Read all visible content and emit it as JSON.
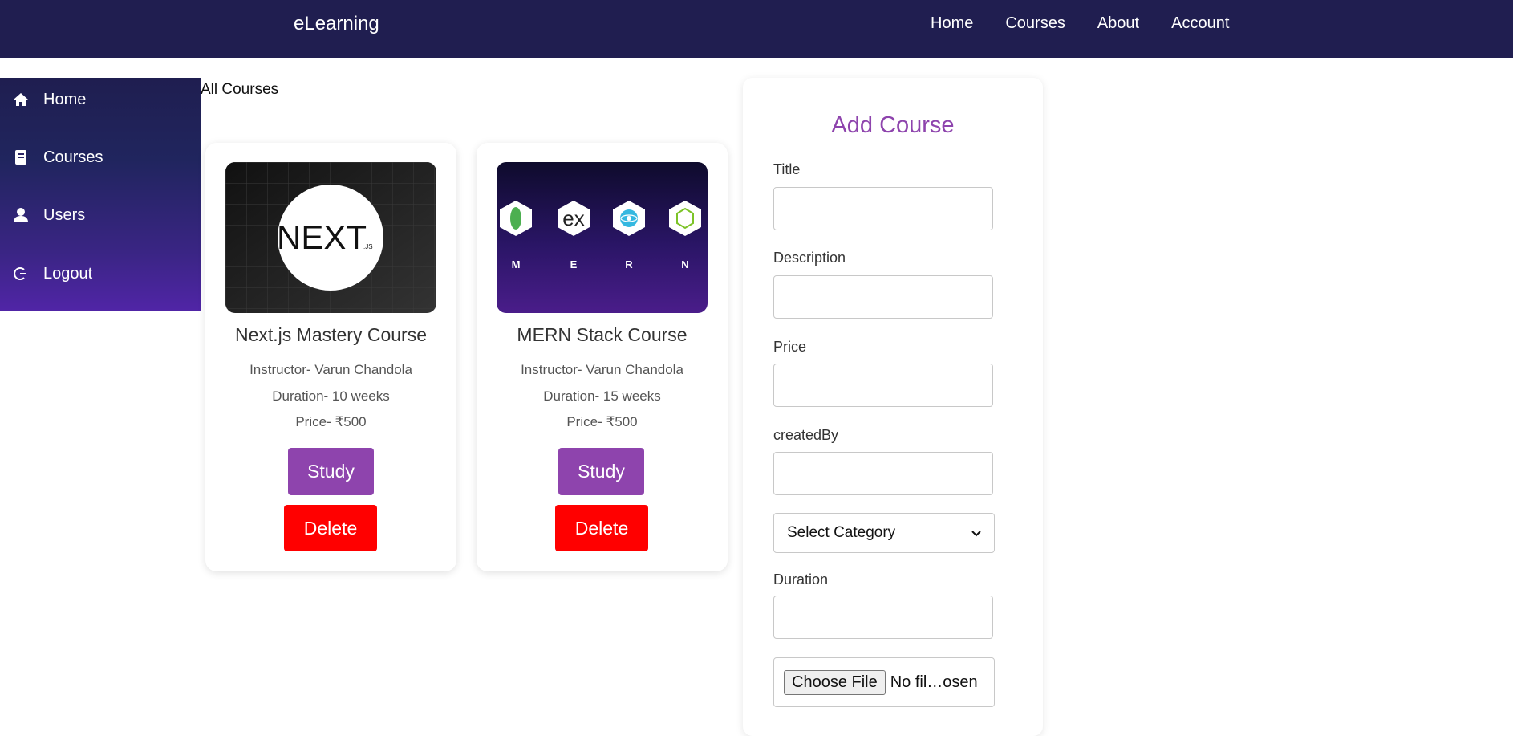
{
  "topbar": {
    "brand": "eLearning",
    "nav": [
      "Home",
      "Courses",
      "About",
      "Account"
    ]
  },
  "sidebar": {
    "items": [
      {
        "label": "Home",
        "icon": "home-icon"
      },
      {
        "label": "Courses",
        "icon": "book-icon"
      },
      {
        "label": "Users",
        "icon": "user-icon"
      },
      {
        "label": "Logout",
        "icon": "logout-icon"
      }
    ]
  },
  "main": {
    "heading": "All Courses",
    "courses": [
      {
        "title": "Next.js Mastery Course",
        "instructor": "Instructor- Varun Chandola",
        "duration": "Duration- 10 weeks",
        "price": "Price- ₹500",
        "study_label": "Study",
        "delete_label": "Delete",
        "thumb_text": "NEXT",
        "thumb_sub": ".JS"
      },
      {
        "title": "MERN Stack Course",
        "instructor": "Instructor- Varun Chandola",
        "duration": "Duration- 15 weeks",
        "price": "Price- ₹500",
        "study_label": "Study",
        "delete_label": "Delete",
        "thumb_letters": [
          "M",
          "E",
          "R",
          "N"
        ],
        "thumb_ex": "ex"
      }
    ]
  },
  "form": {
    "title": "Add Course",
    "labels": {
      "title": "Title",
      "description": "Description",
      "price": "Price",
      "created_by": "createdBy",
      "duration": "Duration"
    },
    "category_selected": "Select Category",
    "file_button": "Choose File",
    "file_status": "No fil…osen"
  },
  "colors": {
    "topbar": "#201e50",
    "accent": "#8e44ad",
    "danger": "#ff0000"
  }
}
